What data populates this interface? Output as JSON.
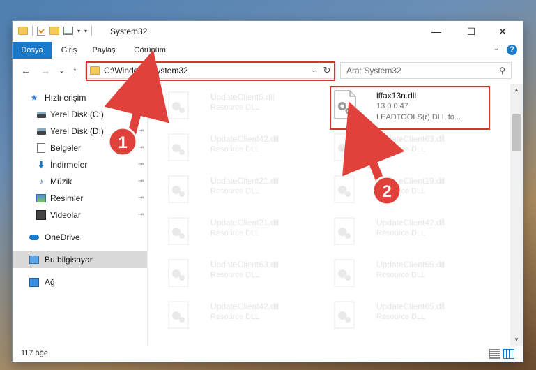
{
  "window": {
    "title": "System32",
    "min_glyph": "—",
    "max_glyph": "☐",
    "close_glyph": "✕"
  },
  "ribbon": {
    "tabs": [
      "Dosya",
      "Giriş",
      "Paylaş",
      "Görünüm"
    ],
    "help_glyph": "?"
  },
  "nav": {
    "back": "←",
    "forward": "→",
    "recent": "⌄",
    "up": "↑"
  },
  "address": {
    "path": "C:\\Windows\\System32",
    "dropdown": "⌄",
    "refresh": "↻"
  },
  "search": {
    "placeholder": "Ara: System32",
    "icon_glyph": "⚲"
  },
  "sidebar": {
    "items": [
      {
        "label": "Hızlı erişim"
      },
      {
        "label": "Yerel Disk (C:)"
      },
      {
        "label": "Yerel Disk (D:)"
      },
      {
        "label": "Belgeler"
      },
      {
        "label": "İndirmeler"
      },
      {
        "label": "Müzik"
      },
      {
        "label": "Resimler"
      },
      {
        "label": "Videolar"
      },
      {
        "label": "OneDrive"
      },
      {
        "label": "Bu bilgisayar"
      },
      {
        "label": "Ağ"
      }
    ],
    "pin_glyph": "📌"
  },
  "files": {
    "left": [
      {
        "name": "UpdateClient5.dll",
        "desc": "Resource DLL"
      },
      {
        "name": "UpdateClient42.dll",
        "desc": "Resource DLL"
      },
      {
        "name": "UpdateClient21.dll",
        "desc": "Resource DLL"
      },
      {
        "name": "UpdateClient21.dll",
        "desc": "Resource DLL"
      },
      {
        "name": "UpdateClient63.dll",
        "desc": "Resource DLL"
      },
      {
        "name": "UpdateClient42.dll",
        "desc": "Resource DLL"
      }
    ],
    "highlight": {
      "name": "lffax13n.dll",
      "version": "13.0.0.47",
      "company": "LEADTOOLS(r) DLL fo..."
    },
    "right": [
      {
        "name": "UpdateClient63.dll",
        "desc": "Resource DLL"
      },
      {
        "name": "UpdateClient19.dll",
        "desc": "Resource DLL"
      },
      {
        "name": "UpdateClient42.dll",
        "desc": "Resource DLL"
      },
      {
        "name": "UpdateClient65.dll",
        "desc": "Resource DLL"
      },
      {
        "name": "UpdateClient65.dll",
        "desc": "Resource DLL"
      }
    ]
  },
  "status": {
    "count": "117 öğe"
  },
  "annotations": {
    "step1": "1",
    "step2": "2",
    "accent": "#d9342b"
  }
}
